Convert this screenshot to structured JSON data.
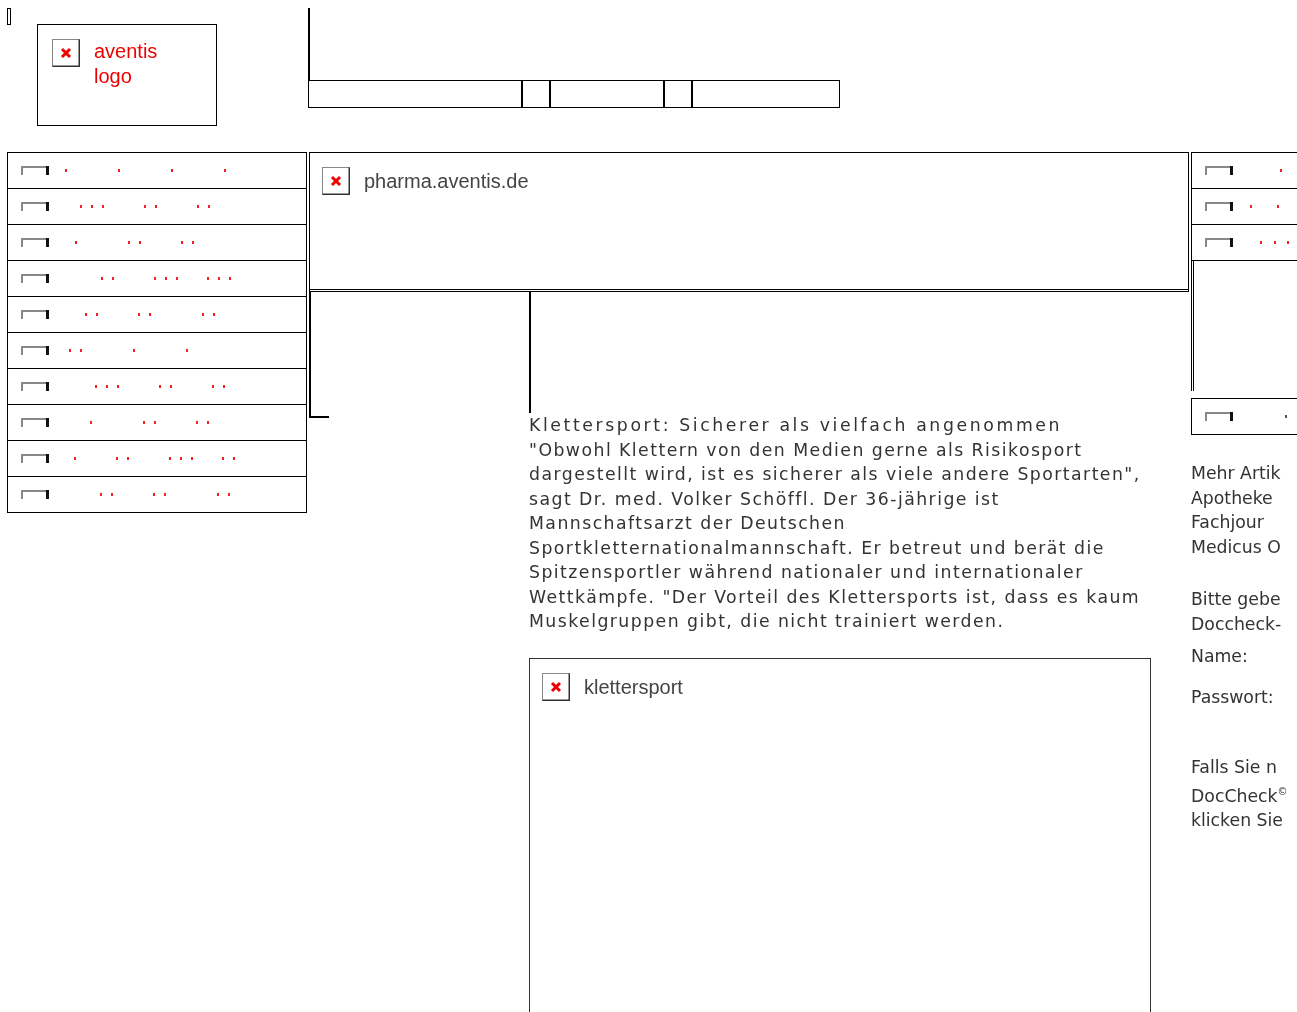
{
  "logo": {
    "alt": "aventis logo"
  },
  "top_nav": {
    "cells": [
      {
        "kind": "wide"
      },
      {
        "kind": "narrow"
      },
      {
        "kind": "medium"
      },
      {
        "kind": "narrow"
      },
      {
        "kind": "wide"
      }
    ]
  },
  "left_menu": {
    "items": [
      {
        "kind": "broken-image"
      },
      {
        "kind": "broken-image"
      },
      {
        "kind": "broken-image"
      },
      {
        "kind": "broken-image"
      },
      {
        "kind": "broken-image"
      },
      {
        "kind": "broken-image"
      },
      {
        "kind": "broken-image"
      },
      {
        "kind": "broken-image"
      },
      {
        "kind": "broken-image"
      },
      {
        "kind": "broken-image"
      }
    ]
  },
  "banner": {
    "alt": "pharma.aventis.de"
  },
  "article": {
    "title": "Klettersport: Sicherer als vielfach angenommen",
    "body": "\"Obwohl Klettern von den Medien gerne als Risikosport dargestellt wird, ist es sicherer als viele andere Sportarten\", sagt Dr. med. Volker Schöffl. Der 36-jährige ist Mannschaftsarzt der Deutschen Sportkletternationalmannschaft. Er betreut und berät die Spitzensportler während nationaler und internationaler Wettkämpfe. \"Der Vorteil des Klettersports ist, dass es kaum Muskelgruppen gibt, die nicht trainiert werden.",
    "image_alt": "klettersport"
  },
  "right_menu": {
    "items": [
      {
        "kind": "broken-image"
      },
      {
        "kind": "broken-image"
      },
      {
        "kind": "broken-image"
      }
    ]
  },
  "right_box": {
    "kind": "broken-image"
  },
  "more_articles_lines": [
    "Mehr Artik",
    "Apotheke",
    "Fachjour",
    "Medicus O"
  ],
  "login": {
    "prompt_lines": [
      "Bitte gebe",
      "Doccheck-"
    ],
    "name_label": "Name:",
    "password_label": "Passwort:",
    "register_lines": [
      "Falls Sie n",
      "DocCheck$^{©}$",
      "klicken Sie"
    ]
  }
}
